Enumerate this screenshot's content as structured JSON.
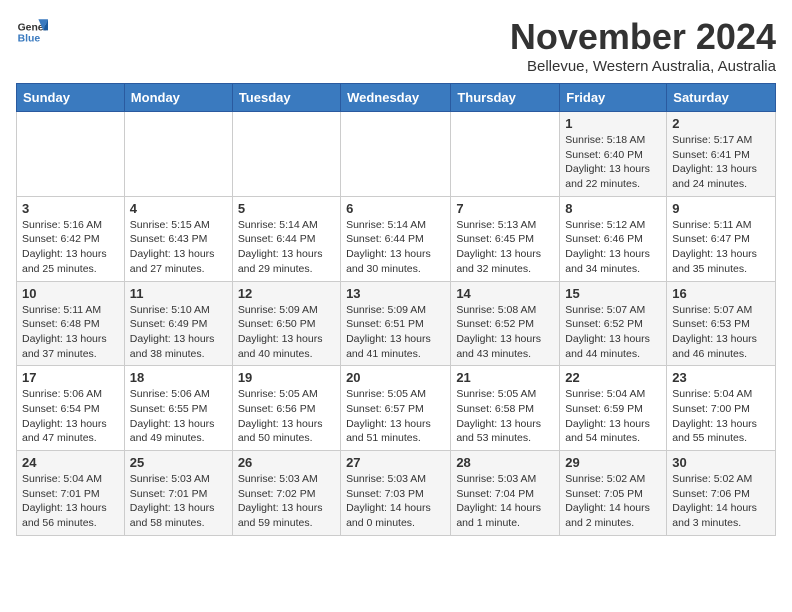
{
  "logo": {
    "general": "General",
    "blue": "Blue"
  },
  "title": "November 2024",
  "subtitle": "Bellevue, Western Australia, Australia",
  "days_of_week": [
    "Sunday",
    "Monday",
    "Tuesday",
    "Wednesday",
    "Thursday",
    "Friday",
    "Saturday"
  ],
  "weeks": [
    [
      {
        "day": "",
        "info": ""
      },
      {
        "day": "",
        "info": ""
      },
      {
        "day": "",
        "info": ""
      },
      {
        "day": "",
        "info": ""
      },
      {
        "day": "",
        "info": ""
      },
      {
        "day": "1",
        "info": "Sunrise: 5:18 AM\nSunset: 6:40 PM\nDaylight: 13 hours and 22 minutes."
      },
      {
        "day": "2",
        "info": "Sunrise: 5:17 AM\nSunset: 6:41 PM\nDaylight: 13 hours and 24 minutes."
      }
    ],
    [
      {
        "day": "3",
        "info": "Sunrise: 5:16 AM\nSunset: 6:42 PM\nDaylight: 13 hours and 25 minutes."
      },
      {
        "day": "4",
        "info": "Sunrise: 5:15 AM\nSunset: 6:43 PM\nDaylight: 13 hours and 27 minutes."
      },
      {
        "day": "5",
        "info": "Sunrise: 5:14 AM\nSunset: 6:44 PM\nDaylight: 13 hours and 29 minutes."
      },
      {
        "day": "6",
        "info": "Sunrise: 5:14 AM\nSunset: 6:44 PM\nDaylight: 13 hours and 30 minutes."
      },
      {
        "day": "7",
        "info": "Sunrise: 5:13 AM\nSunset: 6:45 PM\nDaylight: 13 hours and 32 minutes."
      },
      {
        "day": "8",
        "info": "Sunrise: 5:12 AM\nSunset: 6:46 PM\nDaylight: 13 hours and 34 minutes."
      },
      {
        "day": "9",
        "info": "Sunrise: 5:11 AM\nSunset: 6:47 PM\nDaylight: 13 hours and 35 minutes."
      }
    ],
    [
      {
        "day": "10",
        "info": "Sunrise: 5:11 AM\nSunset: 6:48 PM\nDaylight: 13 hours and 37 minutes."
      },
      {
        "day": "11",
        "info": "Sunrise: 5:10 AM\nSunset: 6:49 PM\nDaylight: 13 hours and 38 minutes."
      },
      {
        "day": "12",
        "info": "Sunrise: 5:09 AM\nSunset: 6:50 PM\nDaylight: 13 hours and 40 minutes."
      },
      {
        "day": "13",
        "info": "Sunrise: 5:09 AM\nSunset: 6:51 PM\nDaylight: 13 hours and 41 minutes."
      },
      {
        "day": "14",
        "info": "Sunrise: 5:08 AM\nSunset: 6:52 PM\nDaylight: 13 hours and 43 minutes."
      },
      {
        "day": "15",
        "info": "Sunrise: 5:07 AM\nSunset: 6:52 PM\nDaylight: 13 hours and 44 minutes."
      },
      {
        "day": "16",
        "info": "Sunrise: 5:07 AM\nSunset: 6:53 PM\nDaylight: 13 hours and 46 minutes."
      }
    ],
    [
      {
        "day": "17",
        "info": "Sunrise: 5:06 AM\nSunset: 6:54 PM\nDaylight: 13 hours and 47 minutes."
      },
      {
        "day": "18",
        "info": "Sunrise: 5:06 AM\nSunset: 6:55 PM\nDaylight: 13 hours and 49 minutes."
      },
      {
        "day": "19",
        "info": "Sunrise: 5:05 AM\nSunset: 6:56 PM\nDaylight: 13 hours and 50 minutes."
      },
      {
        "day": "20",
        "info": "Sunrise: 5:05 AM\nSunset: 6:57 PM\nDaylight: 13 hours and 51 minutes."
      },
      {
        "day": "21",
        "info": "Sunrise: 5:05 AM\nSunset: 6:58 PM\nDaylight: 13 hours and 53 minutes."
      },
      {
        "day": "22",
        "info": "Sunrise: 5:04 AM\nSunset: 6:59 PM\nDaylight: 13 hours and 54 minutes."
      },
      {
        "day": "23",
        "info": "Sunrise: 5:04 AM\nSunset: 7:00 PM\nDaylight: 13 hours and 55 minutes."
      }
    ],
    [
      {
        "day": "24",
        "info": "Sunrise: 5:04 AM\nSunset: 7:01 PM\nDaylight: 13 hours and 56 minutes."
      },
      {
        "day": "25",
        "info": "Sunrise: 5:03 AM\nSunset: 7:01 PM\nDaylight: 13 hours and 58 minutes."
      },
      {
        "day": "26",
        "info": "Sunrise: 5:03 AM\nSunset: 7:02 PM\nDaylight: 13 hours and 59 minutes."
      },
      {
        "day": "27",
        "info": "Sunrise: 5:03 AM\nSunset: 7:03 PM\nDaylight: 14 hours and 0 minutes."
      },
      {
        "day": "28",
        "info": "Sunrise: 5:03 AM\nSunset: 7:04 PM\nDaylight: 14 hours and 1 minute."
      },
      {
        "day": "29",
        "info": "Sunrise: 5:02 AM\nSunset: 7:05 PM\nDaylight: 14 hours and 2 minutes."
      },
      {
        "day": "30",
        "info": "Sunrise: 5:02 AM\nSunset: 7:06 PM\nDaylight: 14 hours and 3 minutes."
      }
    ]
  ]
}
